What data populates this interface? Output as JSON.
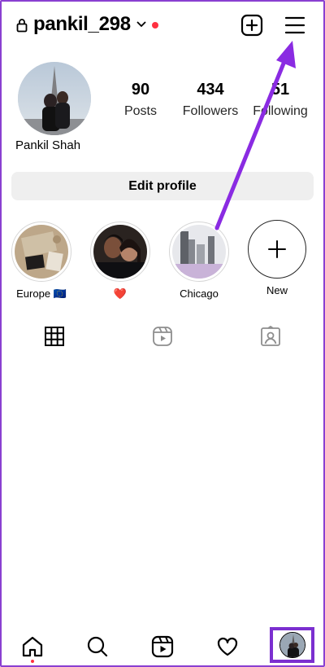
{
  "header": {
    "username": "pankil_298",
    "icons": [
      "lock-icon",
      "chevron-down-icon",
      "notification-dot",
      "add-post-icon",
      "hamburger-menu-icon"
    ]
  },
  "profile": {
    "display_name": "Pankil Shah",
    "stats": [
      {
        "value": "90",
        "label": "Posts"
      },
      {
        "value": "434",
        "label": "Followers"
      },
      {
        "value": "51",
        "label": "Following"
      }
    ],
    "edit_label": "Edit profile"
  },
  "highlights": [
    {
      "label": "Europe 🇪🇺"
    },
    {
      "label": "❤️"
    },
    {
      "label": "Chicago"
    },
    {
      "label": "New"
    }
  ],
  "tabs": [
    "grid-icon",
    "reels-icon",
    "tagged-icon"
  ],
  "nav": [
    "home-icon",
    "search-icon",
    "reels-icon",
    "heart-icon",
    "profile-avatar"
  ],
  "colors": {
    "accent_purple": "#7b2fd0",
    "notification_red": "#ff3040",
    "button_bg": "#efefef"
  }
}
